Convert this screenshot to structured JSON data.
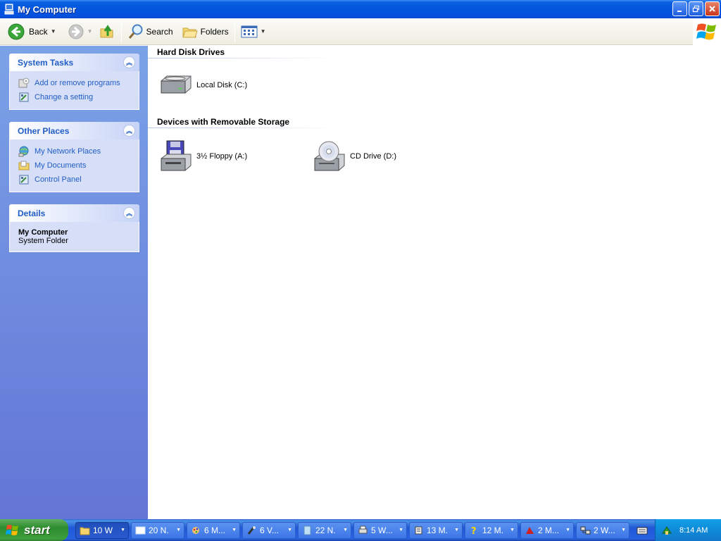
{
  "window": {
    "title": "My Computer"
  },
  "toolbar": {
    "back_label": "Back",
    "search_label": "Search",
    "folders_label": "Folders"
  },
  "sidebar": {
    "system_tasks": {
      "title": "System Tasks",
      "items": [
        {
          "label": "Add or remove programs",
          "icon": "add-remove-programs-icon"
        },
        {
          "label": "Change a setting",
          "icon": "control-panel-icon"
        }
      ]
    },
    "other_places": {
      "title": "Other Places",
      "items": [
        {
          "label": "My Network Places",
          "icon": "network-places-icon"
        },
        {
          "label": "My Documents",
          "icon": "documents-folder-icon"
        },
        {
          "label": "Control Panel",
          "icon": "control-panel-icon"
        }
      ]
    },
    "details": {
      "title": "Details",
      "name": "My Computer",
      "type": "System Folder"
    }
  },
  "main": {
    "groups": [
      {
        "title": "Hard Disk Drives",
        "items": [
          {
            "label": "Local Disk (C:)",
            "icon": "hard-disk-icon"
          }
        ]
      },
      {
        "title": "Devices with Removable Storage",
        "items": [
          {
            "label": "3½ Floppy (A:)",
            "icon": "floppy-drive-icon"
          },
          {
            "label": "CD Drive (D:)",
            "icon": "cd-drive-icon"
          }
        ]
      }
    ]
  },
  "taskbar": {
    "start_label": "start",
    "items": [
      {
        "label": "10 W",
        "icon": "folder-icon",
        "active": true
      },
      {
        "label": "20 N.",
        "icon": "window-icon"
      },
      {
        "label": "6 M...",
        "icon": "paint-icon"
      },
      {
        "label": "6 V...",
        "icon": "tool-icon"
      },
      {
        "label": "22 N.",
        "icon": "notepad-icon"
      },
      {
        "label": "5 W...",
        "icon": "printer-icon"
      },
      {
        "label": "13 M.",
        "icon": "app-icon"
      },
      {
        "label": "12 M.",
        "icon": "help-icon"
      },
      {
        "label": "2 M...",
        "icon": "game-icon"
      },
      {
        "label": "2 W...",
        "icon": "network-icon"
      }
    ],
    "clock": "8:14 AM"
  },
  "colors": {
    "titlebar_blue": "#0456de",
    "task_link_blue": "#215dc6",
    "taskpane_blue": "#6375d6",
    "start_green": "#3c9f3c"
  }
}
